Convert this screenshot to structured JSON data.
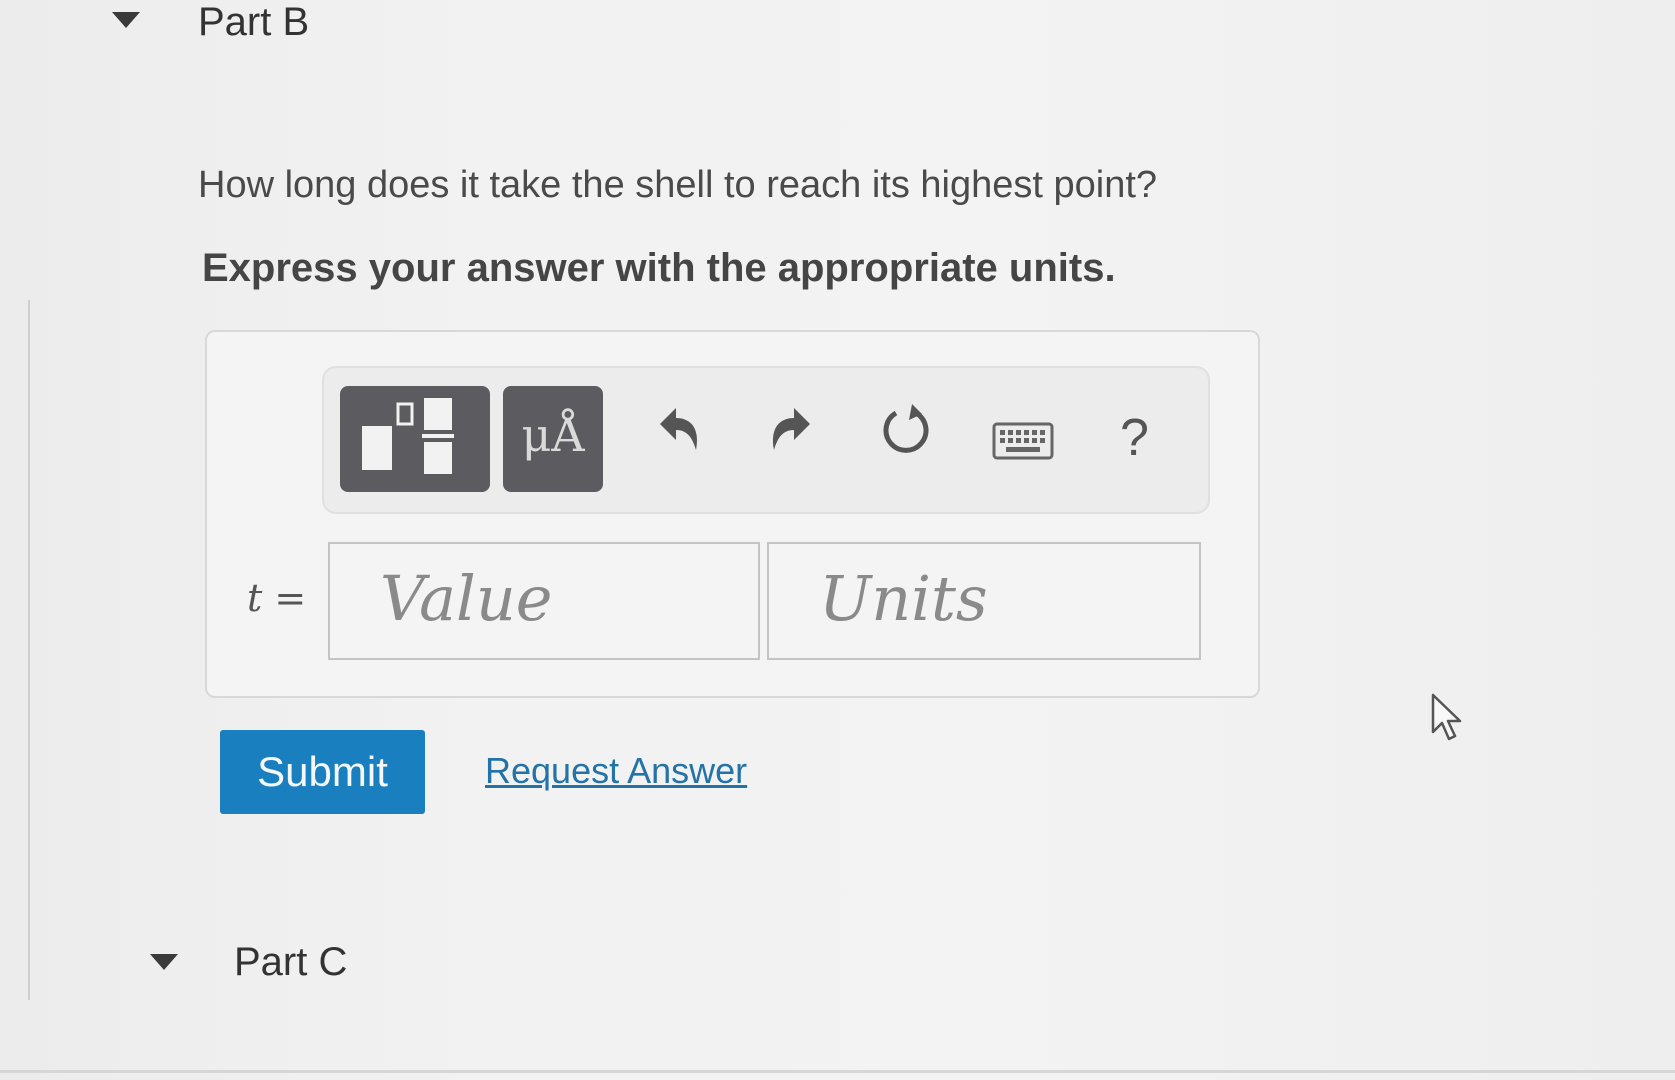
{
  "part_b": {
    "title": "Part B",
    "question": "How long does it take the shell to reach its highest point?",
    "instruction": "Express your answer with the appropriate units."
  },
  "toolbar": {
    "templates_icon": "fraction-template-icon",
    "symbols_label": "μÅ",
    "undo_icon": "undo-icon",
    "redo_icon": "redo-icon",
    "reset_icon": "reset-icon",
    "keyboard_icon": "keyboard-icon",
    "help_label": "?"
  },
  "answer": {
    "variable": "t",
    "equals": "=",
    "value_placeholder": "Value",
    "units_placeholder": "Units"
  },
  "actions": {
    "submit_label": "Submit",
    "request_label": "Request Answer"
  },
  "part_c": {
    "title": "Part C"
  },
  "colors": {
    "submit_bg": "#1a7fbe",
    "link": "#2373a8",
    "tool_dark": "#5b5b60"
  }
}
